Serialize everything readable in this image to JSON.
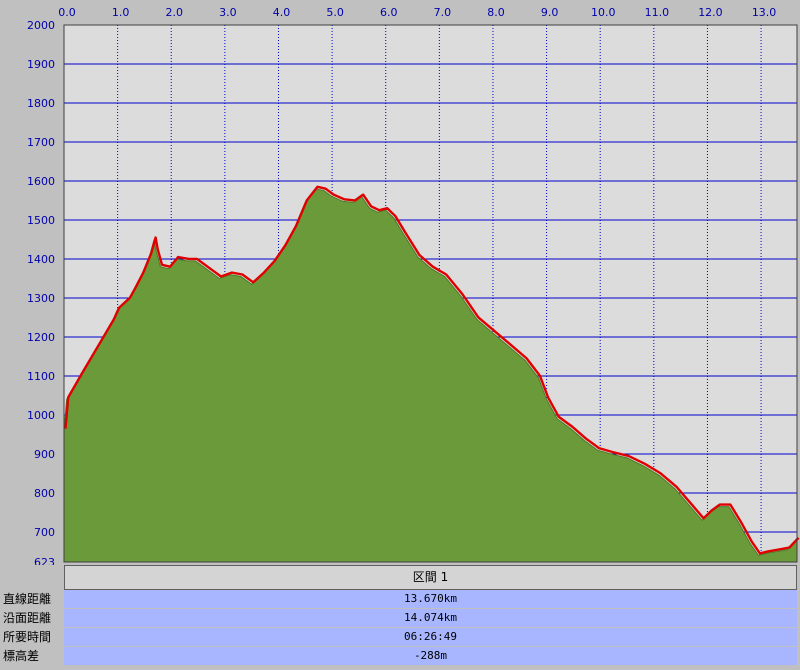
{
  "chart_data": {
    "type": "area",
    "xlim": [
      0.0,
      13.67
    ],
    "ylim": [
      623,
      2000
    ],
    "x_ticks": [
      "0.0",
      "1.0",
      "2.0",
      "3.0",
      "4.0",
      "5.0",
      "6.0",
      "7.0",
      "8.0",
      "9.0",
      "10.0",
      "11.0",
      "12.0",
      "13.0"
    ],
    "y_ticks": [
      "2000",
      "1900",
      "1800",
      "1700",
      "1600",
      "1500",
      "1400",
      "1300",
      "1200",
      "1100",
      "1000",
      "900",
      "800",
      "700",
      "623"
    ],
    "grid": true,
    "colors": {
      "fill": "#6a9a3a",
      "line": "#e00000",
      "plot_bg": "#dcdcdc",
      "grid": "#0000cc"
    },
    "series": [
      {
        "x": [
          0.0,
          0.05,
          0.3,
          0.6,
          0.9,
          1.0,
          1.2,
          1.3,
          1.45,
          1.6,
          1.68,
          1.72,
          1.8,
          1.95,
          2.1,
          2.3,
          2.45,
          2.7,
          2.9,
          3.1,
          3.3,
          3.5,
          3.7,
          3.9,
          4.1,
          4.3,
          4.5,
          4.7,
          4.85,
          5.0,
          5.2,
          5.4,
          5.55,
          5.7,
          5.85,
          6.0,
          6.15,
          6.35,
          6.6,
          6.85,
          7.1,
          7.4,
          7.7,
          8.0,
          8.3,
          8.6,
          8.85,
          9.0,
          9.2,
          9.45,
          9.7,
          9.95,
          10.2,
          10.5,
          10.8,
          11.1,
          11.4,
          11.65,
          11.9,
          12.05,
          12.2,
          12.4,
          12.6,
          12.8,
          12.95,
          13.1,
          13.3,
          13.5,
          13.67
        ],
        "y": [
          960,
          1040,
          1100,
          1170,
          1240,
          1270,
          1295,
          1320,
          1360,
          1410,
          1450,
          1420,
          1380,
          1375,
          1400,
          1395,
          1395,
          1370,
          1350,
          1360,
          1355,
          1335,
          1360,
          1390,
          1430,
          1480,
          1545,
          1580,
          1575,
          1560,
          1548,
          1545,
          1560,
          1530,
          1520,
          1525,
          1505,
          1460,
          1405,
          1375,
          1355,
          1305,
          1245,
          1210,
          1175,
          1140,
          1095,
          1040,
          990,
          965,
          935,
          910,
          900,
          890,
          870,
          845,
          810,
          770,
          730,
          750,
          765,
          765,
          720,
          670,
          640,
          645,
          650,
          655,
          680
        ]
      }
    ]
  },
  "summary": {
    "section_title": "区間 1",
    "rows": [
      {
        "label": "直線距離",
        "value": "13.670km"
      },
      {
        "label": "沿面距離",
        "value": "14.074km"
      },
      {
        "label": "所要時間",
        "value": "06:26:49"
      },
      {
        "label": "標高差",
        "value": "-288m"
      }
    ]
  }
}
